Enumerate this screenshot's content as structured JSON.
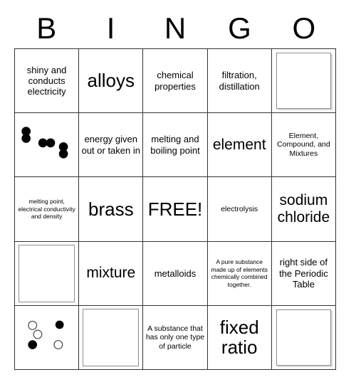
{
  "card": {
    "title_letters": [
      "B",
      "I",
      "N",
      "G",
      "O"
    ]
  },
  "colors": {
    "grid_line": "#333333",
    "text": "#000000",
    "background": "#ffffff",
    "circle_outline": "#555555",
    "circle_filled": "#000000",
    "image_frame": "#8c8c8c",
    "image_shadow": "#d8d8d8"
  },
  "cells": [
    {
      "id": "B1",
      "type": "text",
      "text": "shiny and conducts electricity",
      "size": "md"
    },
    {
      "id": "I1",
      "type": "text",
      "text": "alloys",
      "size": "xxl"
    },
    {
      "id": "N1",
      "type": "text",
      "text": "chemical properties",
      "size": "md"
    },
    {
      "id": "G1",
      "type": "text",
      "text": "filtration, distillation",
      "size": "md"
    },
    {
      "id": "O1",
      "type": "diagram",
      "diagram": "four-open-circles",
      "text": ""
    },
    {
      "id": "B2",
      "type": "diagram",
      "diagram": "three-black-pairs",
      "text": ""
    },
    {
      "id": "I2",
      "type": "text",
      "text": "energy given out or taken in",
      "size": "md"
    },
    {
      "id": "N2",
      "type": "text",
      "text": "melting and boiling point",
      "size": "md"
    },
    {
      "id": "G2",
      "type": "text",
      "text": "element",
      "size": "xl"
    },
    {
      "id": "O2",
      "type": "text",
      "text": "Element, Compound, and Mixtures",
      "size": "sm"
    },
    {
      "id": "B3",
      "type": "text",
      "text": "melting point, electrical conductivity and density",
      "size": "xs"
    },
    {
      "id": "I3",
      "type": "text",
      "text": "brass",
      "size": "xxl"
    },
    {
      "id": "N3",
      "type": "text",
      "text": "FREE!",
      "size": "xxl"
    },
    {
      "id": "G3",
      "type": "text",
      "text": "electrolysis",
      "size": "sm"
    },
    {
      "id": "O3",
      "type": "text",
      "text": "sodium chloride",
      "size": "xl"
    },
    {
      "id": "B4",
      "type": "diagram",
      "diagram": "two-triatomic-molecules",
      "text": ""
    },
    {
      "id": "I4",
      "type": "text",
      "text": "mixture",
      "size": "xl"
    },
    {
      "id": "N4",
      "type": "text",
      "text": "metalloids",
      "size": "md"
    },
    {
      "id": "G4",
      "type": "text",
      "text": "A pure substance made up of elements chemically combined together.",
      "size": "xs"
    },
    {
      "id": "O4",
      "type": "text",
      "text": "right side of the Periodic Table",
      "size": "md"
    },
    {
      "id": "B5",
      "type": "diagram",
      "diagram": "mixed-loose-atoms",
      "text": ""
    },
    {
      "id": "I5",
      "type": "diagram",
      "diagram": "mixed-pairs-and-atoms",
      "text": ""
    },
    {
      "id": "N5",
      "type": "text",
      "text": "A substance that has only one type of particle",
      "size": "sm"
    },
    {
      "id": "G5",
      "type": "text",
      "text": "fixed ratio",
      "size": "xxl"
    },
    {
      "id": "O5",
      "type": "diagram",
      "diagram": "dense-particle-field",
      "text": ""
    }
  ]
}
